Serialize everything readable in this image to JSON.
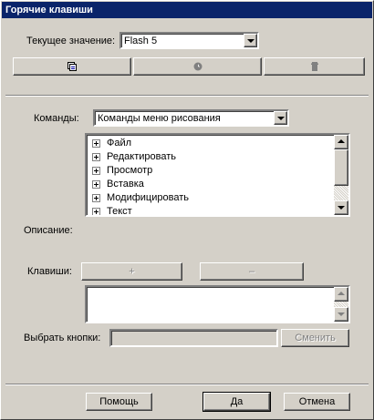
{
  "window": {
    "title": "Горячие клавиши"
  },
  "current_set": {
    "label": "Текущее значение:",
    "value": "Flash 5"
  },
  "set_buttons": {
    "duplicate_icon": "duplicate-set-icon",
    "rename_icon": "rename-set-icon",
    "delete_icon": "trash-icon"
  },
  "commands": {
    "label": "Команды:",
    "value": "Команды меню рисования",
    "items": [
      "Файл",
      "Редактировать",
      "Просмотр",
      "Вставка",
      "Модифицировать",
      "Текст"
    ]
  },
  "description": {
    "label": "Описание:"
  },
  "keys": {
    "label": "Клавиши:",
    "add": "+",
    "remove": "–"
  },
  "press_key": {
    "label": "Выбрать кнопки:",
    "value": "",
    "change": "Сменить"
  },
  "footer": {
    "help": "Помощь",
    "ok": "Да",
    "cancel": "Отмена"
  },
  "colors": {
    "titlebar": "#0a246a",
    "face": "#d4d0c8"
  }
}
